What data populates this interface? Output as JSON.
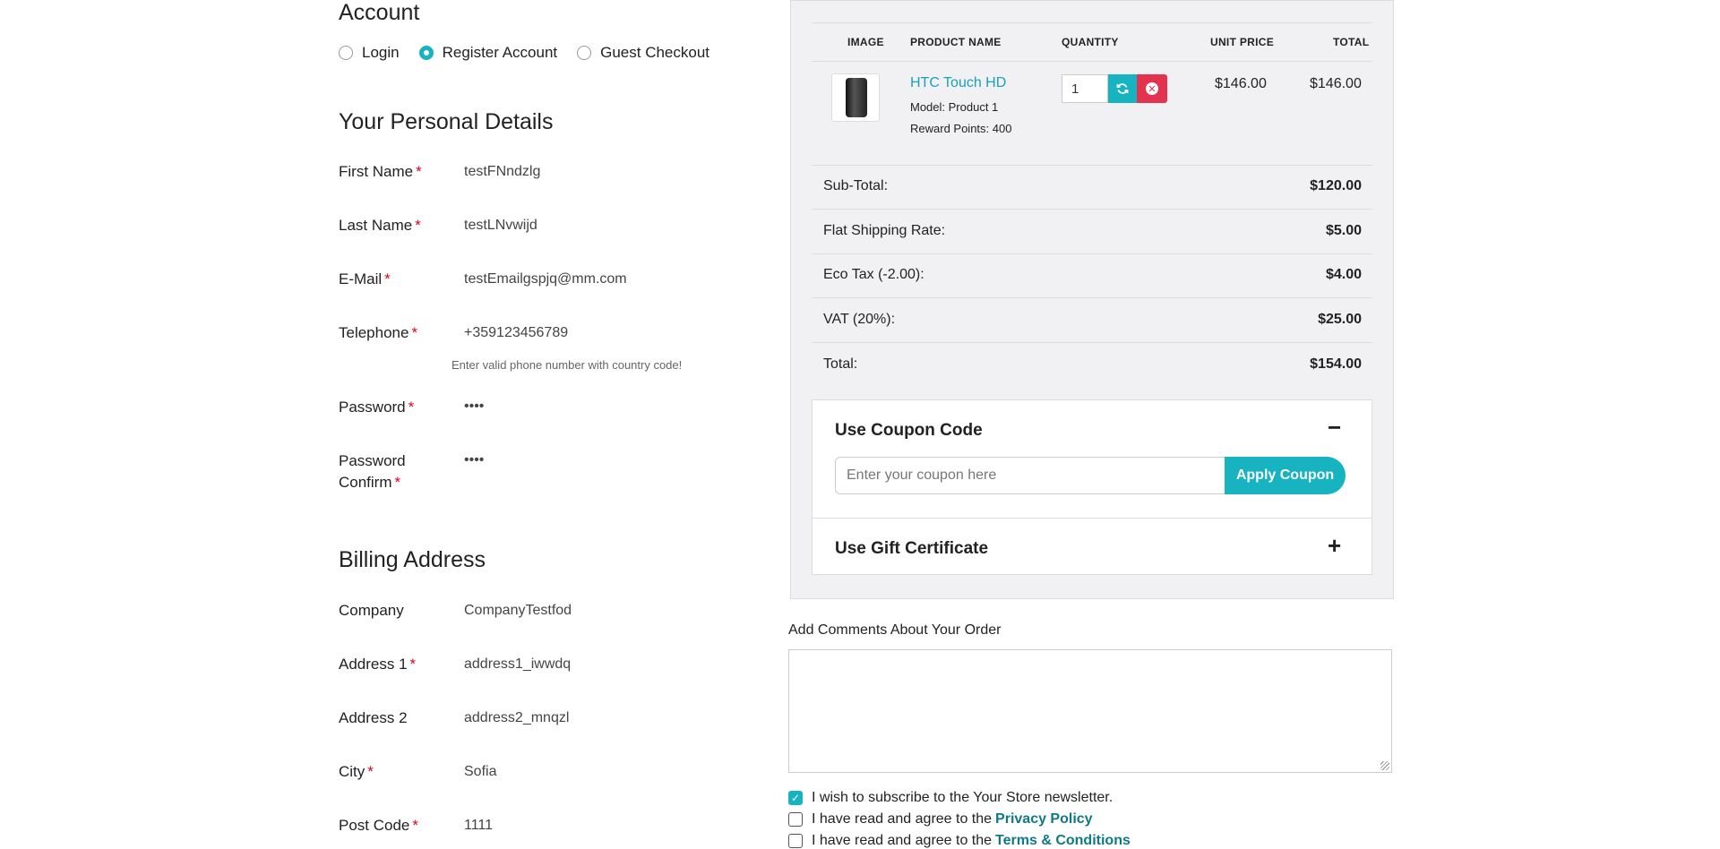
{
  "account": {
    "title": "Account",
    "options": [
      {
        "label": "Login",
        "checked": false
      },
      {
        "label": "Register Account",
        "checked": true
      },
      {
        "label": "Guest Checkout",
        "checked": false
      }
    ]
  },
  "personal": {
    "title": "Your Personal Details",
    "first_name": {
      "label": "First Name",
      "value": "testFNndzlg"
    },
    "last_name": {
      "label": "Last Name",
      "value": "testLNvwijd"
    },
    "email": {
      "label": "E-Mail",
      "value": "testEmailgspjq@mm.com"
    },
    "telephone": {
      "label": "Telephone",
      "value": "+359123456789",
      "help": "Enter valid phone number with country code!"
    },
    "password": {
      "label": "Password",
      "value": "••••"
    },
    "password_confirm": {
      "label_line1": "Password",
      "label_line2": "Confirm",
      "value": "••••"
    }
  },
  "billing": {
    "title": "Billing Address",
    "company": {
      "label": "Company",
      "value": "CompanyTestfod"
    },
    "address1": {
      "label": "Address 1",
      "value": "address1_iwwdq"
    },
    "address2": {
      "label": "Address 2",
      "value": "address2_mnqzl"
    },
    "city": {
      "label": "City",
      "value": "Sofia"
    },
    "postcode": {
      "label": "Post Code",
      "value": "1111"
    }
  },
  "required_marker": "*",
  "cart": {
    "headers": {
      "image": "IMAGE",
      "product_name": "PRODUCT NAME",
      "quantity": "QUANTITY",
      "unit_price": "UNIT PRICE",
      "total": "TOTAL"
    },
    "item": {
      "name": "HTC Touch HD",
      "model": "Model: Product 1",
      "reward": "Reward Points: 400",
      "quantity": "1",
      "unit_price": "$146.00",
      "total": "$146.00"
    },
    "summary": [
      {
        "label": "Sub-Total:",
        "value": "$120.00"
      },
      {
        "label": "Flat Shipping Rate:",
        "value": "$5.00"
      },
      {
        "label": "Eco Tax (-2.00):",
        "value": "$4.00"
      },
      {
        "label": "VAT (20%):",
        "value": "$25.00"
      },
      {
        "label": "Total:",
        "value": "$154.00"
      }
    ],
    "accent_color": "#17b3c1",
    "remove_color": "#e4334f"
  },
  "coupon": {
    "title": "Use Coupon Code",
    "toggle": "−",
    "placeholder": "Enter your coupon here",
    "button": "Apply Coupon"
  },
  "gift": {
    "title": "Use Gift Certificate",
    "toggle": "+"
  },
  "comments": {
    "label": "Add Comments About Your Order"
  },
  "agreements": {
    "newsletter": {
      "text": "I wish to subscribe to the Your Store newsletter.",
      "checked": true
    },
    "privacy": {
      "prefix": "I have read and agree to the",
      "link": "Privacy Policy",
      "checked": false
    },
    "terms": {
      "prefix": "I have read and agree to the",
      "link": "Terms & Conditions",
      "checked": false
    }
  }
}
